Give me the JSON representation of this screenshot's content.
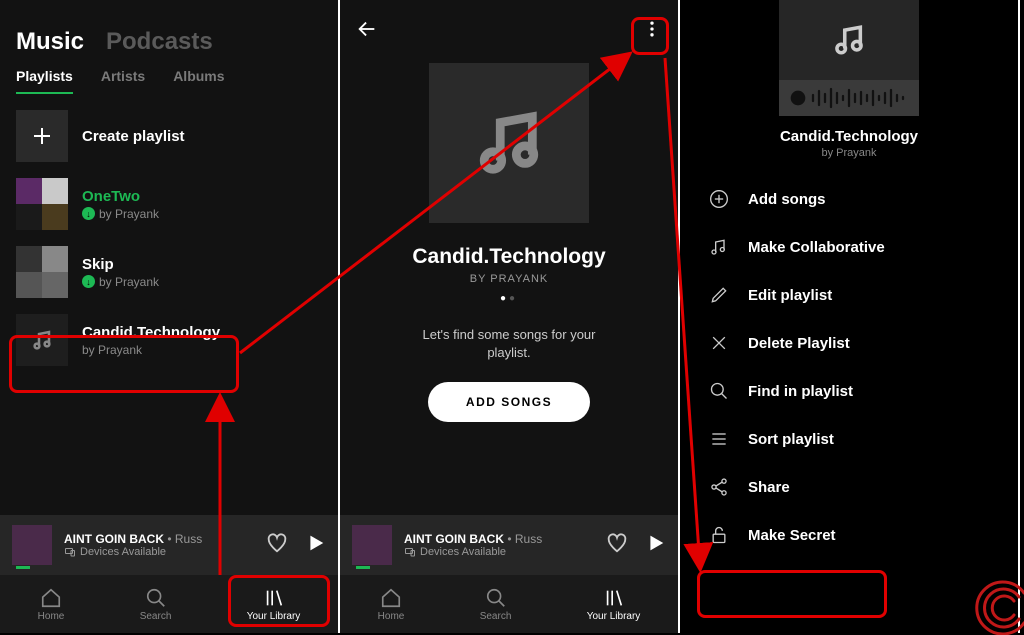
{
  "panel1": {
    "top_tabs": {
      "music": "Music",
      "podcasts": "Podcasts"
    },
    "sub_tabs": {
      "playlists": "Playlists",
      "artists": "Artists",
      "albums": "Albums"
    },
    "create": "Create playlist",
    "playlists": [
      {
        "name": "OneTwo",
        "by": "by Prayank",
        "downloaded": true,
        "green": true
      },
      {
        "name": "Skip",
        "by": "by Prayank",
        "downloaded": true,
        "green": false
      },
      {
        "name": "Candid.Technology",
        "by": "by Prayank",
        "downloaded": false,
        "green": false
      }
    ]
  },
  "nowplaying": {
    "title": "AINT GOIN BACK",
    "artist": "Russ",
    "devices": "Devices Available"
  },
  "nav": {
    "home": "Home",
    "search": "Search",
    "library": "Your Library"
  },
  "panel2": {
    "title": "Candid.Technology",
    "by": "BY PRAYANK",
    "message1": "Let's find some songs for your",
    "message2": "playlist.",
    "button": "ADD SONGS"
  },
  "panel3": {
    "title": "Candid.Technology",
    "by": "by Prayank",
    "menu": {
      "add": "Add songs",
      "collab": "Make Collaborative",
      "edit": "Edit playlist",
      "delete": "Delete Playlist",
      "find": "Find in playlist",
      "sort": "Sort playlist",
      "share": "Share",
      "secret": "Make Secret"
    }
  }
}
